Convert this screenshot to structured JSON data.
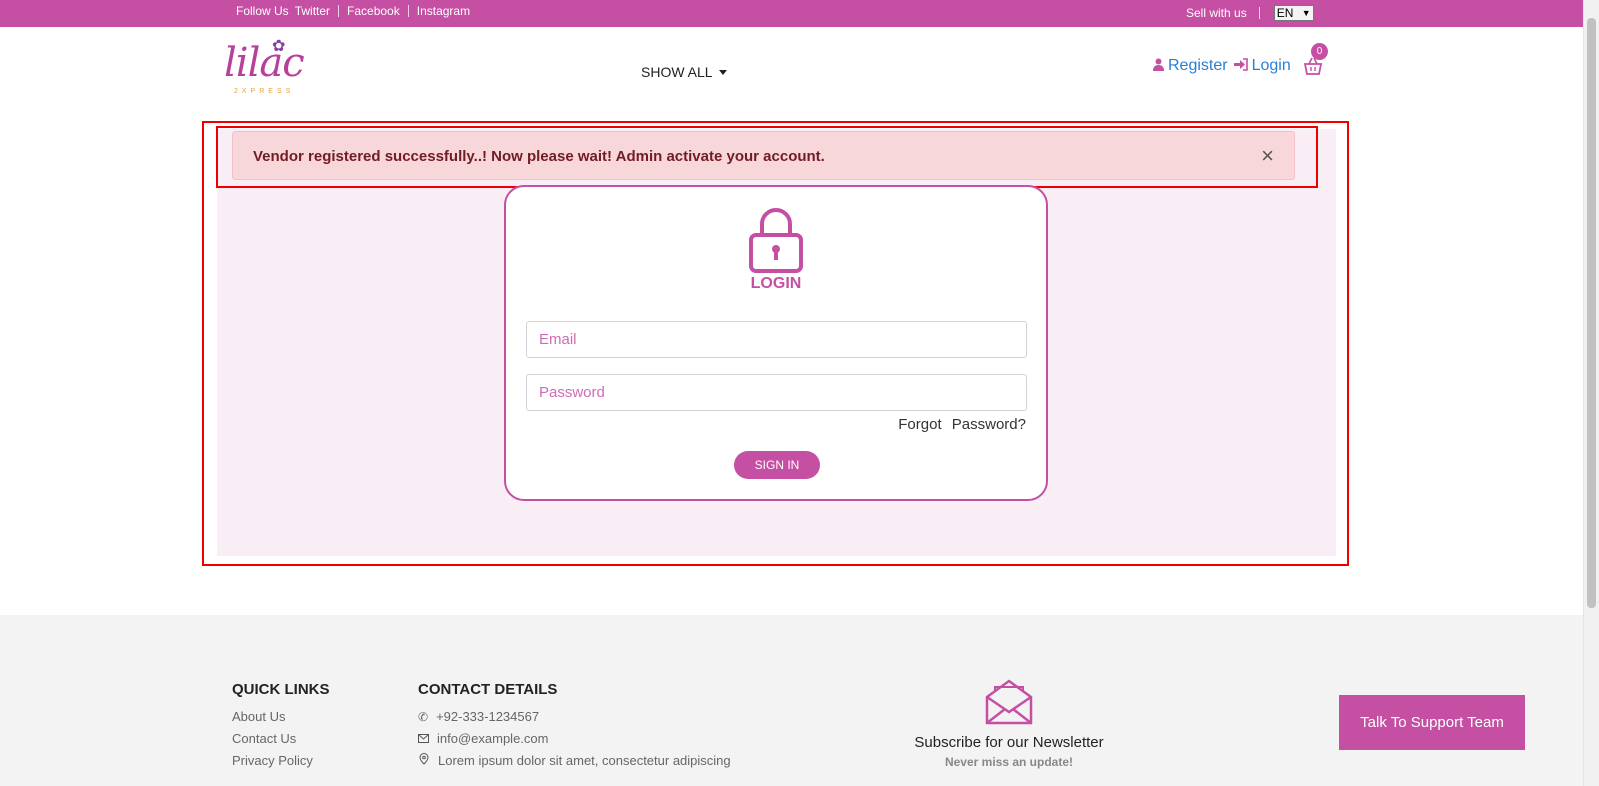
{
  "topbar": {
    "follow": "Follow Us",
    "social": [
      "Twitter",
      "Facebook",
      "Instagram"
    ],
    "sell": "Sell with us",
    "language": "EN"
  },
  "header": {
    "logo_text": "lilac",
    "logo_sub": "2XPRESS",
    "menu": "SHOW ALL",
    "register": "Register",
    "login": "Login",
    "cart_count": "0"
  },
  "alert": {
    "message": "Vendor registered successfully..! Now please wait! Admin activate your account.",
    "close": "×"
  },
  "login": {
    "title": "LOGIN",
    "email_placeholder": "Email",
    "password_placeholder": "Password",
    "forgot": "Forgot Password?",
    "signin": "SIGN IN"
  },
  "footer": {
    "quick_links_title": "QUICK LINKS",
    "quick_links": [
      "About Us",
      "Contact Us",
      "Privacy Policy"
    ],
    "contact_title": "CONTACT DETAILS",
    "phone": "+92-333-1234567",
    "email": "info@example.com",
    "address": "Lorem ipsum dolor sit amet, consectetur adipiscing",
    "newsletter_title": "Subscribe for our Newsletter",
    "newsletter_sub": "Never miss an update!",
    "support": "Talk To Support Team"
  },
  "colors": {
    "brand": "#c54fa3",
    "alert_bg": "#f8d7da",
    "alert_text": "#721c24",
    "link": "#2a7fd6"
  }
}
